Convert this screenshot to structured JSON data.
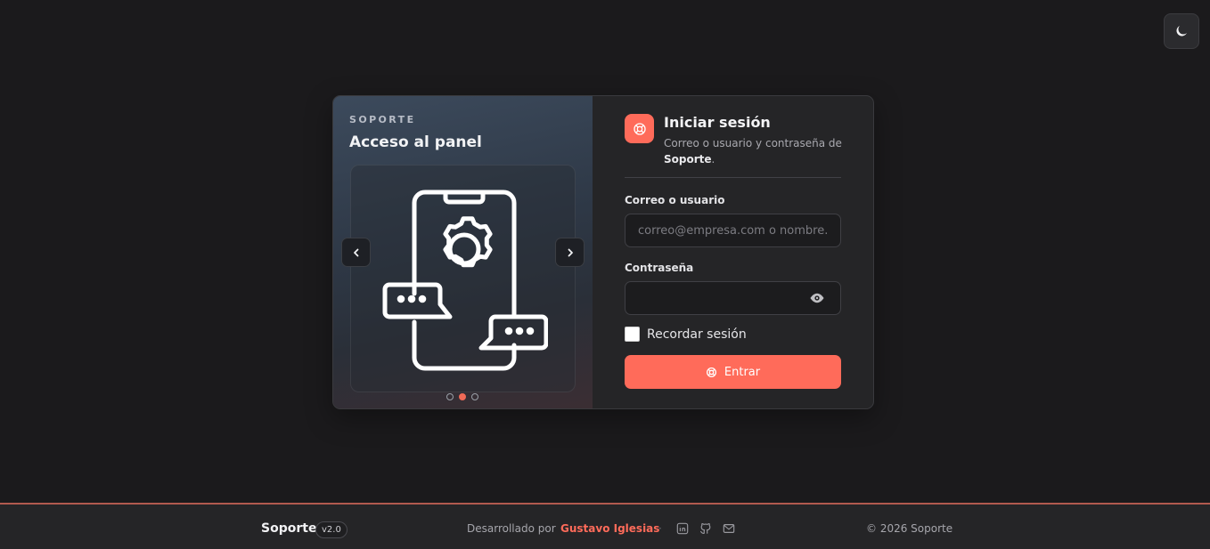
{
  "header": {
    "theme_toggle_icon": "moon-icon"
  },
  "carousel": {
    "kicker": "SOPORTE",
    "title": "Acceso al panel",
    "slide_icon": "smartphone-settings-chat-icon",
    "prev_icon": "chevron-left-icon",
    "next_icon": "chevron-right-icon",
    "slide_count": 3,
    "active_slide": 2
  },
  "login": {
    "title": "Iniciar sesión",
    "subtitle_prefix": "Correo o usuario y contraseña de ",
    "subtitle_app": "Soporte",
    "subtitle_suffix": ".",
    "email_label": "Correo o usuario",
    "email_placeholder": "correo@empresa.com o nombre.de.usuario",
    "email_value": "",
    "password_label": "Contraseña",
    "password_value": "",
    "remember_label": "Recordar sesión",
    "remember_checked": false,
    "submit_label": "Entrar",
    "logo_icon": "lifebuoy-icon"
  },
  "footer": {
    "brand": "Soporte",
    "version": "v2.0",
    "developed_by": "Desarrollado por",
    "author": "Gustavo Iglesias",
    "separator": "·",
    "social_icons": [
      "linkedin-icon",
      "github-icon",
      "mail-icon"
    ],
    "copyright": "© 2026 Soporte"
  },
  "colors": {
    "background": "#1b1a1c",
    "accent": "#ff6b5a",
    "card": "#252527",
    "footer_border": "#b15a4f"
  }
}
